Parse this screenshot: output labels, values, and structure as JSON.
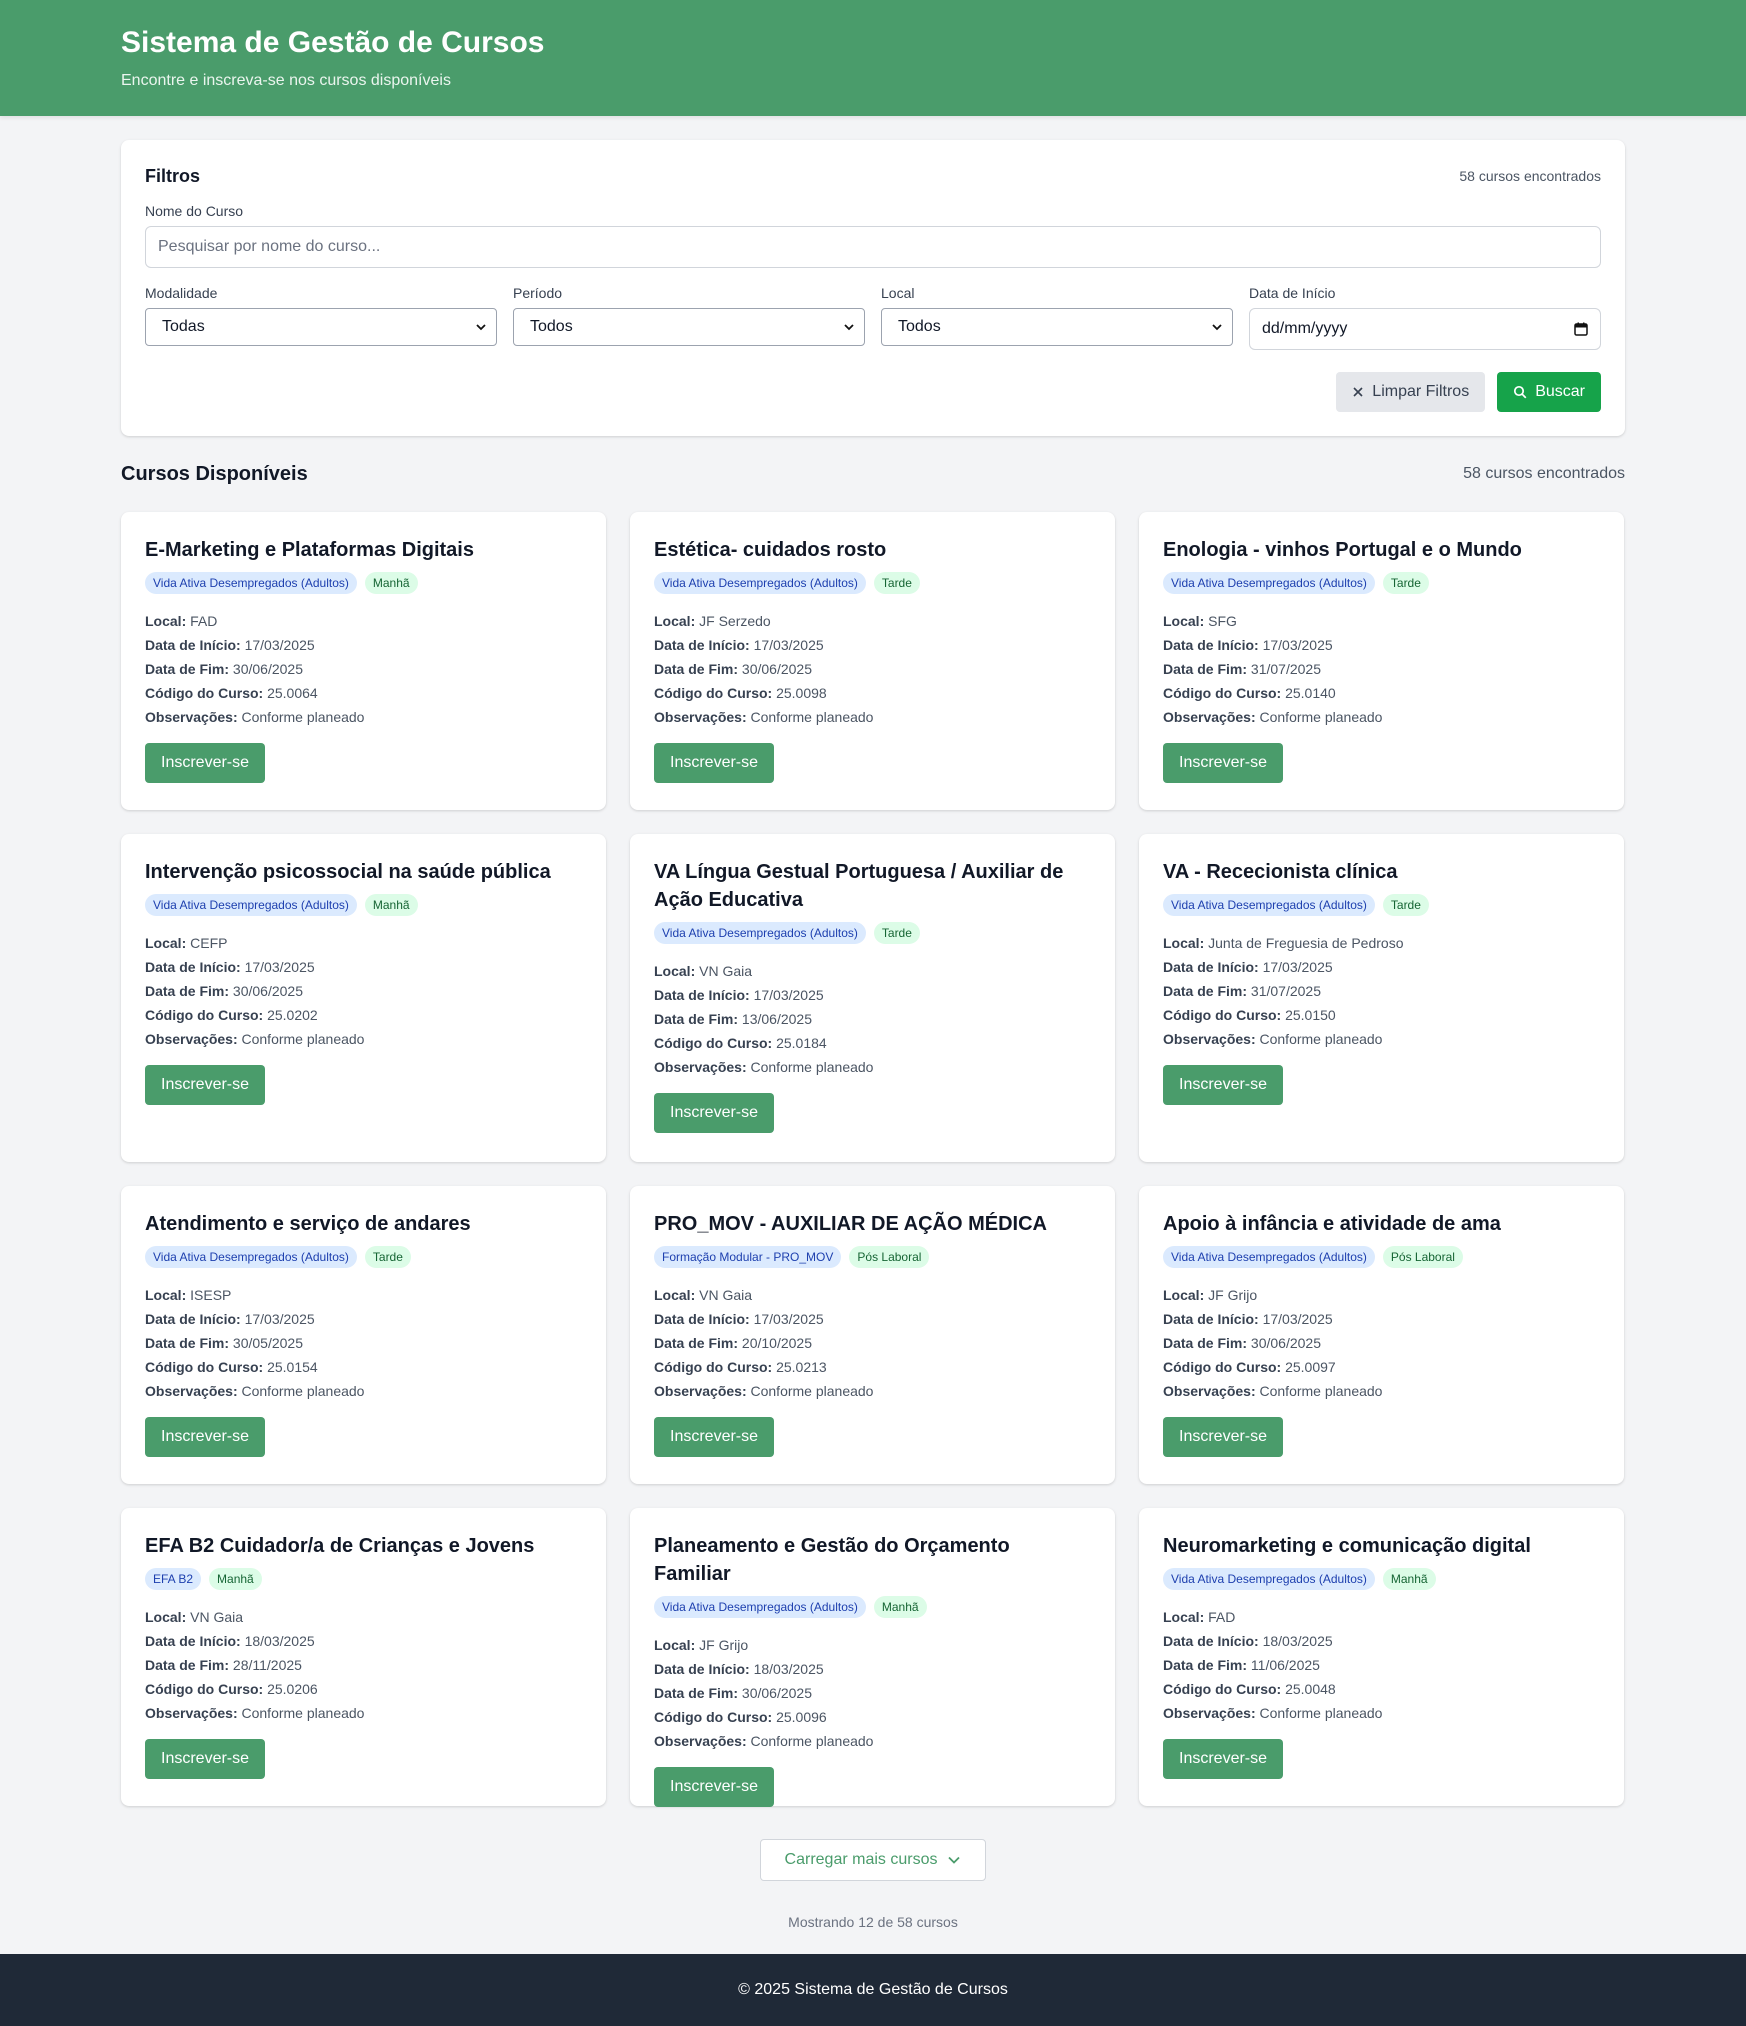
{
  "header": {
    "title": "Sistema de Gestão de Cursos",
    "subtitle": "Encontre e inscreva-se nos cursos disponíveis"
  },
  "filters": {
    "title": "Filtros",
    "count": "58 cursos encontrados",
    "name_label": "Nome do Curso",
    "name_placeholder": "Pesquisar por nome do curso...",
    "modalidade_label": "Modalidade",
    "modalidade_value": "Todas",
    "periodo_label": "Período",
    "periodo_value": "Todos",
    "local_label": "Local",
    "local_value": "Todos",
    "data_label": "Data de Início",
    "data_placeholder": "dd/mm/yyyy",
    "clear_label": "Limpar Filtros",
    "search_label": "Buscar"
  },
  "section": {
    "title": "Cursos Disponíveis",
    "count": "58 cursos encontrados"
  },
  "labels": {
    "local": "Local:",
    "inicio": "Data de Início:",
    "fim": "Data de Fim:",
    "codigo": "Código do Curso:",
    "obs": "Observações:",
    "enroll": "Inscrever-se"
  },
  "courses": [
    {
      "title": "E-Marketing e Plataformas Digitais",
      "modalidade": "Vida Ativa Desempregados (Adultos)",
      "periodo": "Manhã",
      "local": "FAD",
      "inicio": "17/03/2025",
      "fim": "30/06/2025",
      "codigo": "25.0064",
      "obs": "Conforme planeado"
    },
    {
      "title": "Estética- cuidados rosto",
      "modalidade": "Vida Ativa Desempregados (Adultos)",
      "periodo": "Tarde",
      "local": "JF Serzedo",
      "inicio": "17/03/2025",
      "fim": "30/06/2025",
      "codigo": "25.0098",
      "obs": "Conforme planeado"
    },
    {
      "title": "Enologia - vinhos Portugal e o Mundo",
      "modalidade": "Vida Ativa Desempregados (Adultos)",
      "periodo": "Tarde",
      "local": "SFG",
      "inicio": "17/03/2025",
      "fim": "31/07/2025",
      "codigo": "25.0140",
      "obs": "Conforme planeado"
    },
    {
      "title": "Intervenção psicossocial na saúde pública",
      "modalidade": "Vida Ativa Desempregados (Adultos)",
      "periodo": "Manhã",
      "local": "CEFP",
      "inicio": "17/03/2025",
      "fim": "30/06/2025",
      "codigo": "25.0202",
      "obs": "Conforme planeado"
    },
    {
      "title": "VA Língua Gestual Portuguesa / Auxiliar de Ação Educativa",
      "modalidade": "Vida Ativa Desempregados (Adultos)",
      "periodo": "Tarde",
      "local": "VN Gaia",
      "inicio": "17/03/2025",
      "fim": "13/06/2025",
      "codigo": "25.0184",
      "obs": "Conforme planeado"
    },
    {
      "title": "VA - Rececionista clínica",
      "modalidade": "Vida Ativa Desempregados (Adultos)",
      "periodo": "Tarde",
      "local": "Junta de Freguesia de Pedroso",
      "inicio": "17/03/2025",
      "fim": "31/07/2025",
      "codigo": "25.0150",
      "obs": "Conforme planeado"
    },
    {
      "title": "Atendimento e serviço de andares",
      "modalidade": "Vida Ativa Desempregados (Adultos)",
      "periodo": "Tarde",
      "local": "ISESP",
      "inicio": "17/03/2025",
      "fim": "30/05/2025",
      "codigo": "25.0154",
      "obs": "Conforme planeado"
    },
    {
      "title": "PRO_MOV - AUXILIAR DE AÇÃO MÉDICA",
      "modalidade": "Formação Modular - PRO_MOV",
      "periodo": "Pós Laboral",
      "local": "VN Gaia",
      "inicio": "17/03/2025",
      "fim": "20/10/2025",
      "codigo": "25.0213",
      "obs": "Conforme planeado"
    },
    {
      "title": "Apoio à infância e atividade de ama",
      "modalidade": "Vida Ativa Desempregados (Adultos)",
      "periodo": "Pós Laboral",
      "local": "JF Grijo",
      "inicio": "17/03/2025",
      "fim": "30/06/2025",
      "codigo": "25.0097",
      "obs": "Conforme planeado"
    },
    {
      "title": "EFA B2 Cuidador/a de Crianças e Jovens",
      "modalidade": "EFA B2",
      "periodo": "Manhã",
      "local": "VN Gaia",
      "inicio": "18/03/2025",
      "fim": "28/11/2025",
      "codigo": "25.0206",
      "obs": "Conforme planeado"
    },
    {
      "title": "Planeamento e Gestão do Orçamento Familiar",
      "modalidade": "Vida Ativa Desempregados (Adultos)",
      "periodo": "Manhã",
      "local": "JF Grijo",
      "inicio": "18/03/2025",
      "fim": "30/06/2025",
      "codigo": "25.0096",
      "obs": "Conforme planeado"
    },
    {
      "title": "Neuromarketing e comunicação digital",
      "modalidade": "Vida Ativa Desempregados (Adultos)",
      "periodo": "Manhã",
      "local": "FAD",
      "inicio": "18/03/2025",
      "fim": "11/06/2025",
      "codigo": "25.0048",
      "obs": "Conforme planeado"
    }
  ],
  "load_more": "Carregar mais cursos",
  "showing": "Mostrando 12 de 58 cursos",
  "footer": "© 2025 Sistema de Gestão de Cursos",
  "icons": {
    "clear": "close-icon",
    "search": "search-icon",
    "dropdown": "chevron-down-icon",
    "calendar": "calendar-icon"
  },
  "colors": {
    "brand": "#4a9c6b",
    "search_button": "#16a34a",
    "footer": "#1f2937"
  }
}
